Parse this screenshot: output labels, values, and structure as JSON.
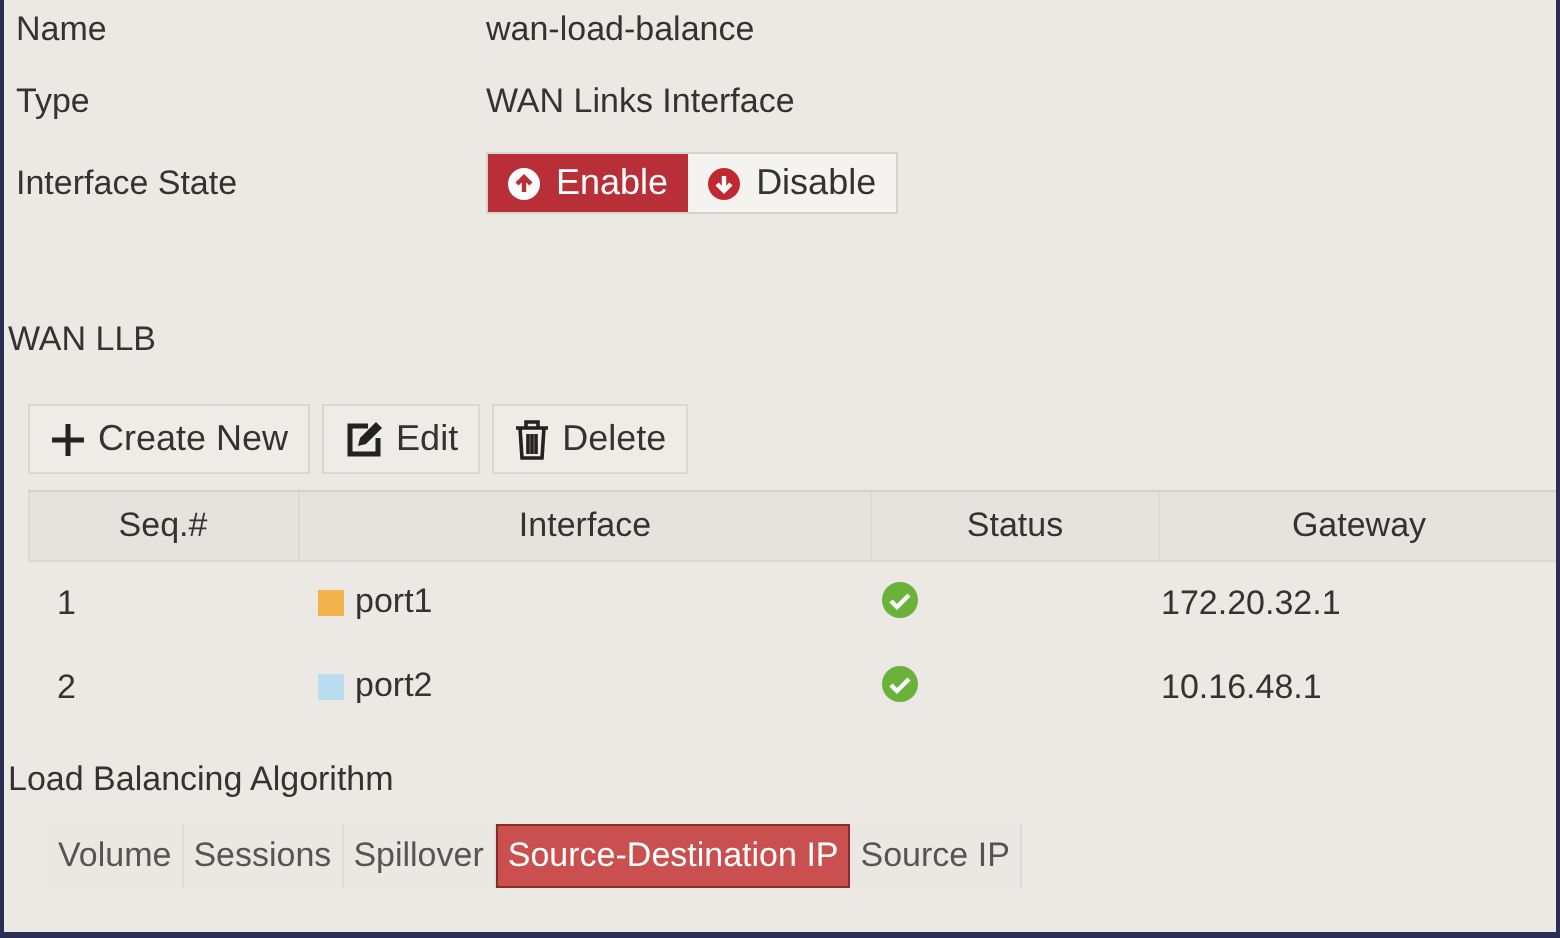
{
  "fields": [
    {
      "label": "Name",
      "value": "wan-load-balance"
    },
    {
      "label": "Type",
      "value": "WAN Links Interface"
    }
  ],
  "interface_state": {
    "label": "Interface State",
    "options": [
      {
        "label": "Enable",
        "kind": "enable",
        "selected": true
      },
      {
        "label": "Disable",
        "kind": "disable",
        "selected": false
      }
    ]
  },
  "section_title": "WAN LLB",
  "toolbar": [
    {
      "label": "Create New",
      "kind": "create"
    },
    {
      "label": "Edit",
      "kind": "edit"
    },
    {
      "label": "Delete",
      "kind": "delete"
    }
  ],
  "table": {
    "columns": [
      "Seq.#",
      "Interface",
      "Status",
      "Gateway"
    ],
    "rows": [
      {
        "seq": "1",
        "interface": "port1",
        "color": "#f2b24c",
        "status_ok": true,
        "gateway": "172.20.32.1"
      },
      {
        "seq": "2",
        "interface": "port2",
        "color": "#b9dcee",
        "status_ok": true,
        "gateway": "10.16.48.1"
      }
    ]
  },
  "algorithm": {
    "label": "Load Balancing Algorithm",
    "tabs": [
      {
        "label": "Volume",
        "selected": false
      },
      {
        "label": "Sessions",
        "selected": false
      },
      {
        "label": "Spillover",
        "selected": false
      },
      {
        "label": "Source-Destination IP",
        "selected": true
      },
      {
        "label": "Source IP",
        "selected": false
      }
    ]
  }
}
